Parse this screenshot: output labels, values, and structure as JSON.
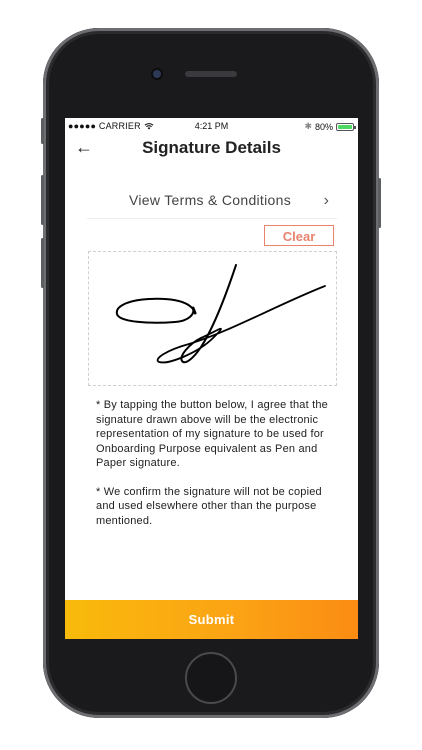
{
  "status_bar": {
    "carrier": "●●●●● CARRIER",
    "wifi_icon": "wifi-icon",
    "time": "4:21 PM",
    "bluetooth": "✱",
    "battery": "80%"
  },
  "header": {
    "back": "←",
    "title": "Signature Details"
  },
  "terms": {
    "label": "View Terms & Conditions",
    "chevron": "›"
  },
  "signature": {
    "clear_label": "Clear"
  },
  "disclaimer": {
    "para1": "* By tapping the button below, I agree that the signature drawn above will be the electronic representation of my signature to be used for Onboarding Purpose  equivalent as Pen and Paper signature.",
    "para2": "* We confirm the signature will not be copied and used elsewhere other than the purpose mentioned."
  },
  "footer": {
    "submit_label": "Submit"
  },
  "colors": {
    "accent": "#fba215",
    "clear": "#e8836e",
    "battery": "#4cd964"
  }
}
